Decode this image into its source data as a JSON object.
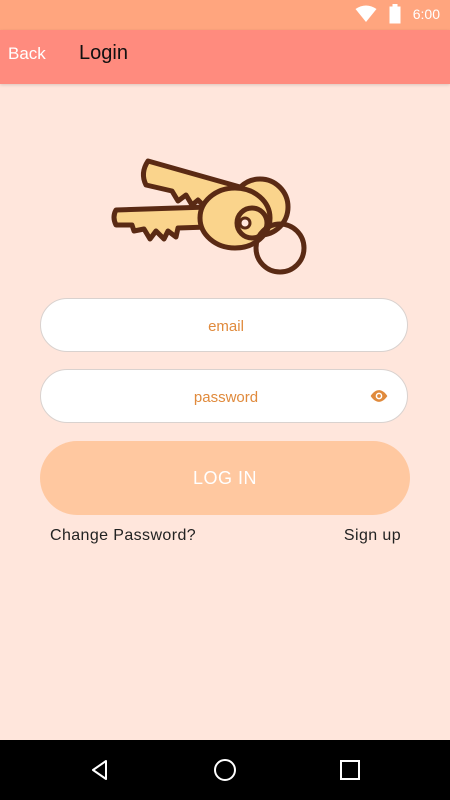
{
  "status_bar": {
    "time": "6:00",
    "icons": [
      "wifi-icon",
      "battery-icon"
    ]
  },
  "app_bar": {
    "back_label": "Back",
    "title": "Login"
  },
  "logo": {
    "icon": "keys-icon"
  },
  "form": {
    "email": {
      "placeholder": "email",
      "value": ""
    },
    "password": {
      "placeholder": "password",
      "value": "",
      "toggle_icon": "eye-icon"
    },
    "login_label": "LOG IN"
  },
  "links": {
    "change_password": "Change Password?",
    "sign_up": "Sign up"
  },
  "nav_bar": {
    "buttons": [
      "back-triangle-icon",
      "home-circle-icon",
      "recents-square-icon"
    ]
  },
  "colors": {
    "status_bar": "#ffa57e",
    "app_bar": "#ff8b7e",
    "background": "#ffe6dc",
    "login_button": "#ffc8a0",
    "accent_text": "#e08a3c",
    "key_fill": "#fad48c",
    "key_outline": "#5a2a14"
  }
}
